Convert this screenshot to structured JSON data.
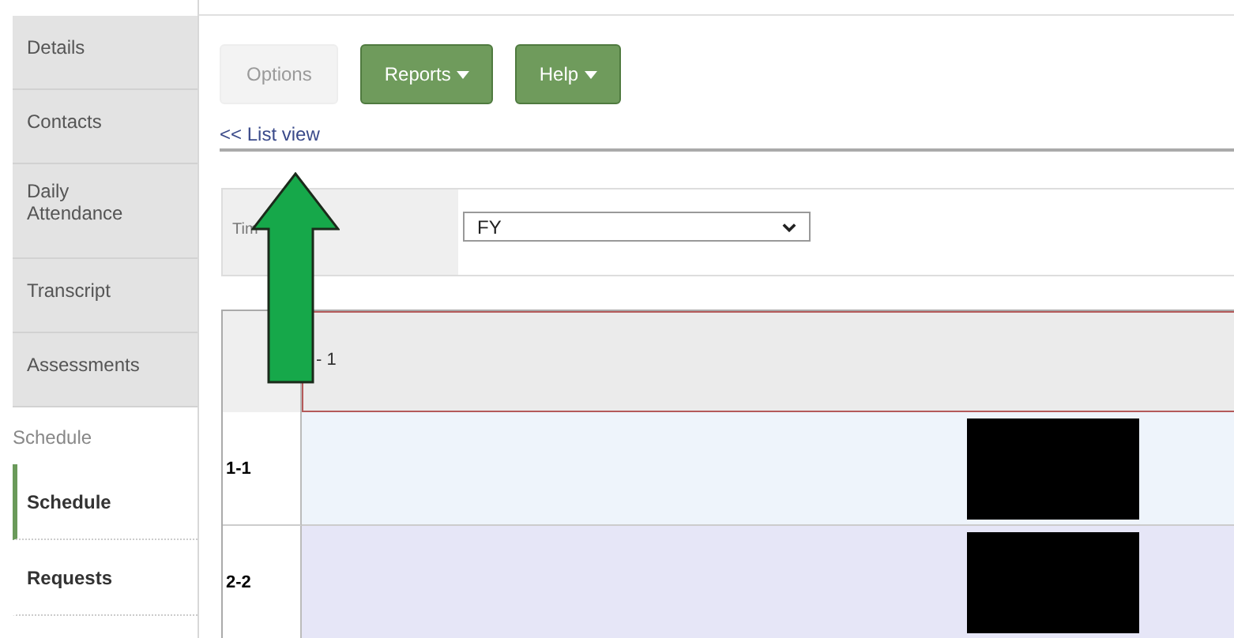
{
  "sidebar": {
    "items": [
      {
        "kind": "tab",
        "label": "Details",
        "selected": false
      },
      {
        "kind": "tab",
        "label": "Contacts",
        "selected": false
      },
      {
        "kind": "tab",
        "label": "Daily Attendance",
        "selected": false
      },
      {
        "kind": "tab",
        "label": "Transcript",
        "selected": false
      },
      {
        "kind": "tab",
        "label": "Assessments",
        "selected": false
      },
      {
        "kind": "section",
        "label": "Schedule",
        "children": [
          {
            "label": "Schedule",
            "selected": true
          },
          {
            "label": "Requests",
            "selected": false
          }
        ]
      }
    ]
  },
  "toolbar": {
    "buttons": [
      {
        "label": "Options",
        "disabled": true,
        "menu": false
      },
      {
        "label": "Reports",
        "disabled": false,
        "menu": true
      },
      {
        "label": "Help",
        "disabled": false,
        "menu": true
      }
    ]
  },
  "back_link": "<< List view",
  "filter": {
    "label": "Tim",
    "value": "FY"
  },
  "grid": {
    "header": "- 1",
    "rows": [
      {
        "label": "1-1",
        "redacted": true
      },
      {
        "label": "2-2",
        "redacted": true
      }
    ]
  }
}
